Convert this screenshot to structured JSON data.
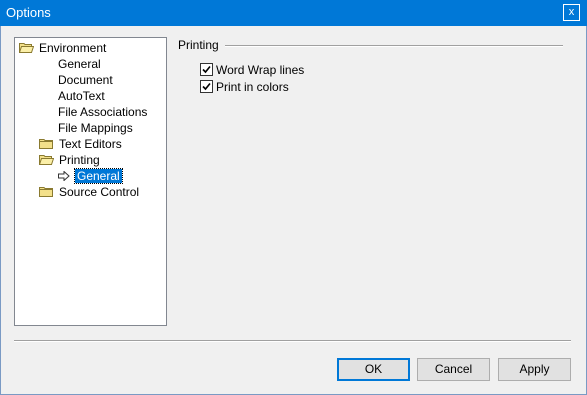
{
  "window": {
    "title": "Options",
    "close_label": "x",
    "accent_color": "#0078d7"
  },
  "tree": {
    "items": [
      {
        "label": "Environment",
        "icon": "open-folder-icon"
      },
      {
        "label": "General",
        "icon": ""
      },
      {
        "label": "Document",
        "icon": ""
      },
      {
        "label": "AutoText",
        "icon": ""
      },
      {
        "label": "File Associations",
        "icon": ""
      },
      {
        "label": "File Mappings",
        "icon": ""
      },
      {
        "label": "Text Editors",
        "icon": "folder-icon"
      },
      {
        "label": "Printing",
        "icon": "open-folder-icon"
      },
      {
        "label": "General",
        "icon": "arrow-right-icon",
        "selected": true
      },
      {
        "label": "Source Control",
        "icon": "folder-icon"
      }
    ]
  },
  "panel": {
    "group_title": "Printing",
    "options": [
      {
        "label": "Word Wrap lines",
        "checked": true
      },
      {
        "label": "Print in colors",
        "checked": true
      }
    ]
  },
  "buttons": {
    "ok": "OK",
    "cancel": "Cancel",
    "apply": "Apply"
  }
}
